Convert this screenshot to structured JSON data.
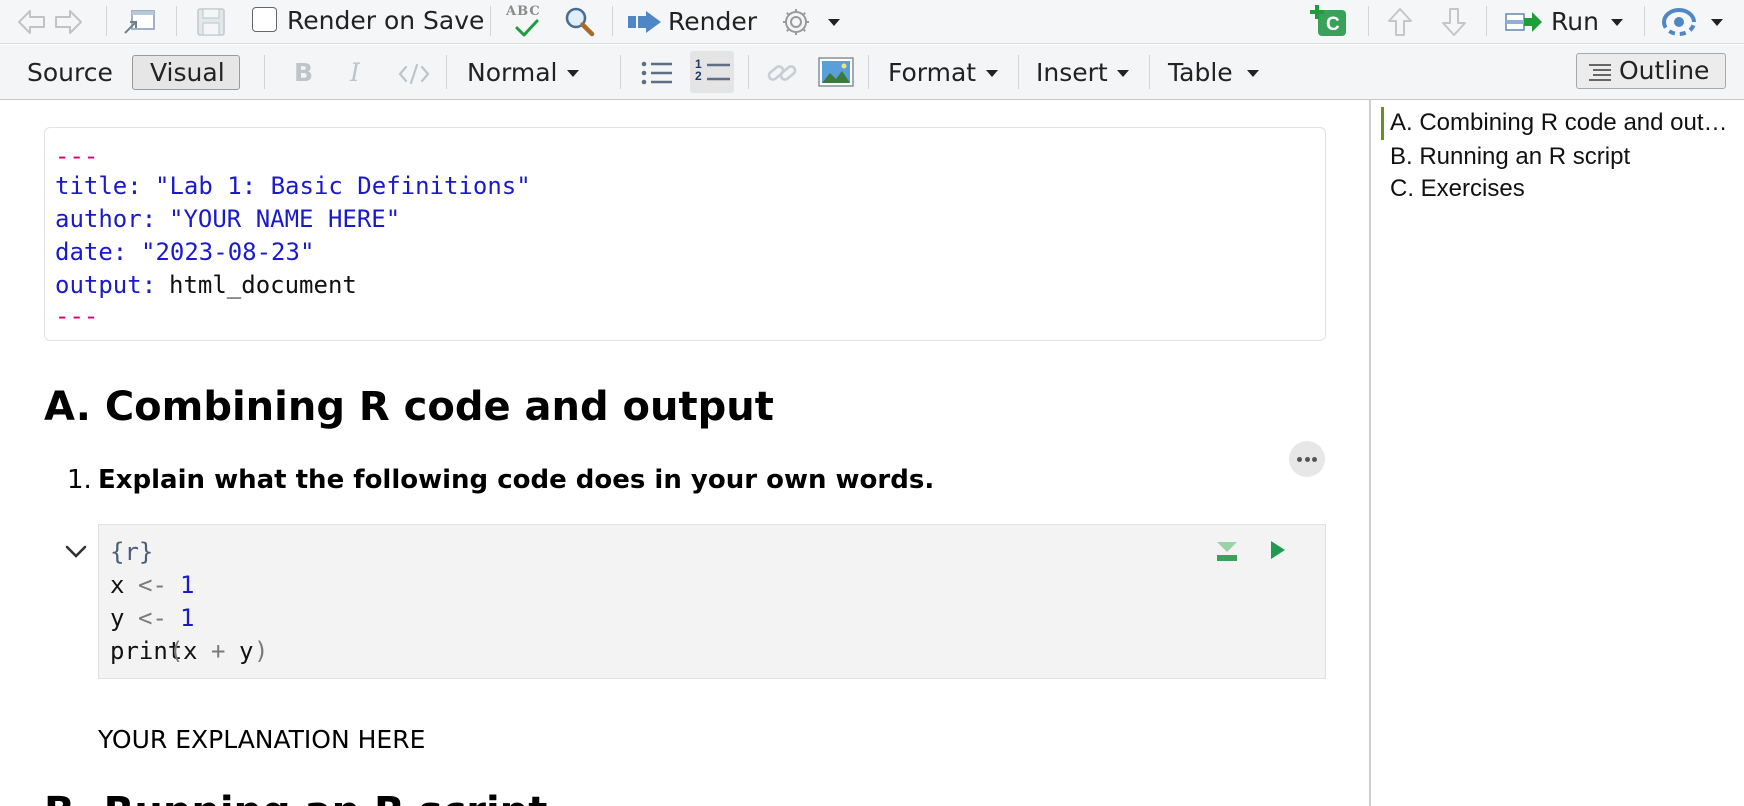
{
  "toolbar_main": {
    "render_on_save_label": "Render on Save",
    "spellcheck_label": "ABC",
    "render_label": "Render",
    "run_label": "Run",
    "new_chunk_letter": "C"
  },
  "toolbar_format": {
    "source_label": "Source",
    "visual_label": "Visual",
    "paragraph_style": "Normal",
    "format_label": "Format",
    "insert_label": "Insert",
    "table_label": "Table",
    "outline_label": "Outline",
    "ordered_list_digits": "12"
  },
  "yaml": {
    "open": "---",
    "title_key": "title:",
    "title_value": "\"Lab 1: Basic Definitions\"",
    "author_key": "author:",
    "author_value": "\"YOUR NAME HERE\"",
    "date_key": "date:",
    "date_value": "\"2023-08-23\"",
    "output_key": "output:",
    "output_value": "html_document",
    "close": "---"
  },
  "section_a": {
    "heading": "A. Combining R code and output",
    "item_number": "1.",
    "item_text": "Explain what the following code does in your own words.",
    "chunk": {
      "header": "{r}",
      "line1_var": "x",
      "line1_op": "<-",
      "line1_val": "1",
      "line2_var": "y",
      "line2_op": "<-",
      "line2_val": "1",
      "line3_fn": "print",
      "line3_open": "(",
      "line3_a": "x",
      "line3_op": "+",
      "line3_b": "y",
      "line3_close": ")"
    },
    "explanation": "YOUR EXPLANATION HERE"
  },
  "section_b_partial": "B. Running an R script",
  "outline": {
    "items": [
      {
        "label": "A. Combining R code and out…",
        "active": true
      },
      {
        "label": "B. Running an R script",
        "active": false
      },
      {
        "label": "C. Exercises",
        "active": false
      }
    ]
  },
  "colors": {
    "yaml_delim": "#d6006f",
    "yaml_blue": "#1a1acc",
    "code_number": "#1a1acc",
    "code_op": "#7a7a7a",
    "run_green": "#1f9b4f",
    "outline_active_bar": "#6b8e23"
  }
}
